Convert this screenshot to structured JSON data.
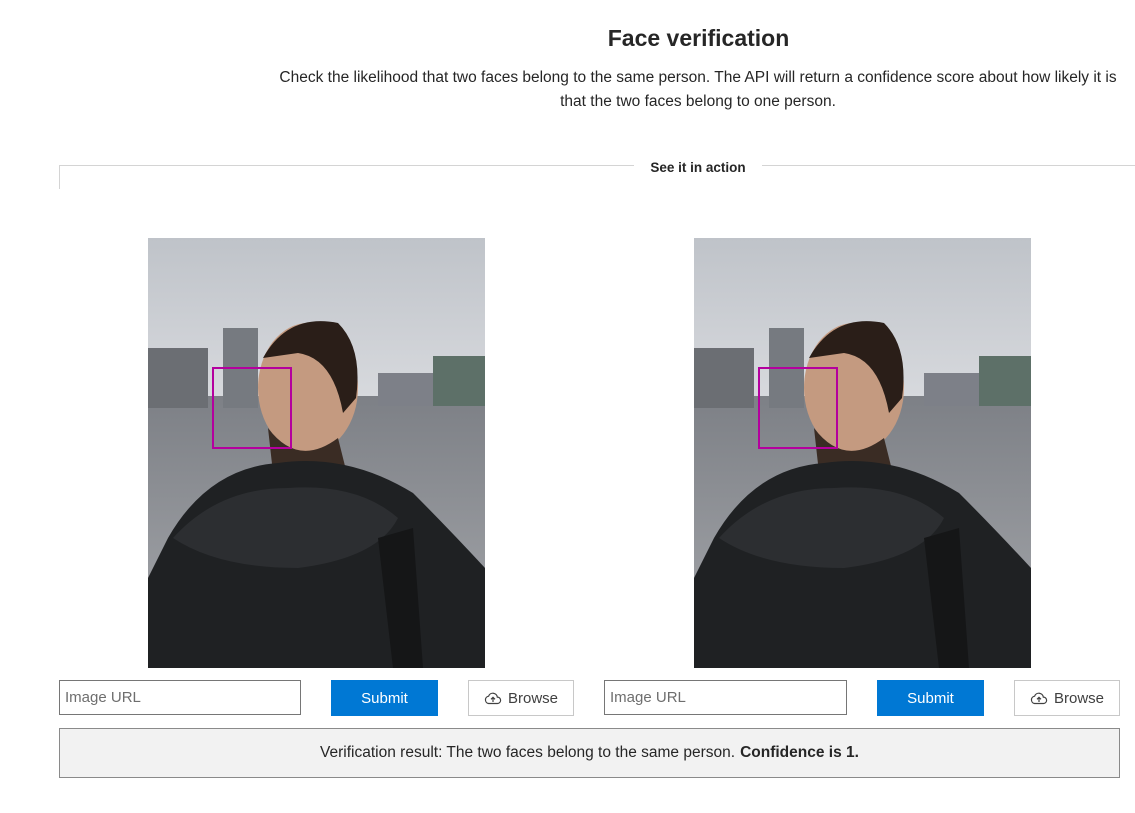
{
  "header": {
    "title": "Face verification",
    "description": "Check the likelihood that two faces belong to the same person. The API will return a confidence score about how likely it is that the two faces belong to one person."
  },
  "section": {
    "label": "See it in action"
  },
  "panels": [
    {
      "image_alt": "Man wearing a dark knit scarf, looking up and to the left, city waterfront background",
      "url_placeholder": "Image URL",
      "submit_label": "Submit",
      "browse_label": "Browse",
      "browse_icon": "cloud-upload-icon"
    },
    {
      "image_alt": "Man wearing a dark knit scarf, looking up and to the left, city waterfront background",
      "url_placeholder": "Image URL",
      "submit_label": "Submit",
      "browse_label": "Browse",
      "browse_icon": "cloud-upload-icon"
    }
  ],
  "result": {
    "text": "Verification result: The two faces belong to the same person.",
    "confidence": "Confidence is 1."
  },
  "colors": {
    "accent": "#0078d4",
    "face_box": "#b4009e",
    "result_background": "#f2f2f2"
  }
}
